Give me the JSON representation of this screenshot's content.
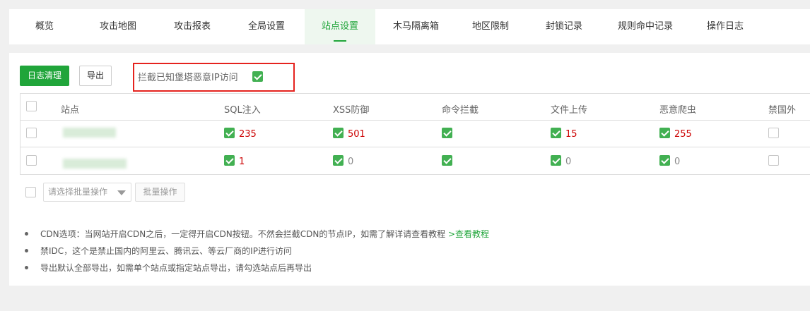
{
  "tabs": [
    {
      "label": "概览",
      "active": false
    },
    {
      "label": "攻击地图",
      "active": false
    },
    {
      "label": "攻击报表",
      "active": false
    },
    {
      "label": "全局设置",
      "active": false
    },
    {
      "label": "站点设置",
      "active": true
    },
    {
      "label": "木马隔离箱",
      "active": false
    },
    {
      "label": "地区限制",
      "active": false
    },
    {
      "label": "封锁记录",
      "active": false
    },
    {
      "label": "规则命中记录",
      "active": false
    },
    {
      "label": "操作日志",
      "active": false
    }
  ],
  "toolbar": {
    "clear_log": "日志清理",
    "export": "导出",
    "block_bastion_label": "拦截已知堡塔恶意IP访问",
    "block_bastion_checked": true
  },
  "table": {
    "headers": [
      "站点",
      "SQL注入",
      "XSS防御",
      "命令拦截",
      "文件上传",
      "恶意爬虫",
      "禁国外"
    ],
    "rows": [
      {
        "sql": "235",
        "xss": "501",
        "cmd": "",
        "upload": "15",
        "crawler": "255",
        "sql_on": true,
        "xss_on": true,
        "cmd_on": true,
        "upload_on": true,
        "crawler_on": true,
        "foreign_on": false
      },
      {
        "sql": "1",
        "xss": "0",
        "cmd": "",
        "upload": "0",
        "crawler": "0",
        "sql_on": true,
        "xss_on": true,
        "cmd_on": true,
        "upload_on": true,
        "crawler_on": true,
        "foreign_on": false
      }
    ]
  },
  "batch": {
    "placeholder": "请选择批量操作",
    "button": "批量操作"
  },
  "tips": [
    {
      "text": "CDN选项：当网站开启CDN之后，一定得开启CDN按钮。不然会拦截CDN的节点IP，如需了解详请查看教程 ",
      "link": ">查看教程"
    },
    {
      "text": "禁IDC，这个是禁止国内的阿里云、腾讯云、等云厂商的IP进行访问",
      "link": ""
    },
    {
      "text": "导出默认全部导出，如需单个站点或指定站点导出，请勾选站点后再导出",
      "link": ""
    }
  ],
  "colors": {
    "accent": "#20a53a",
    "highlight_border": "#e5231e",
    "count_red": "#cc0000"
  }
}
